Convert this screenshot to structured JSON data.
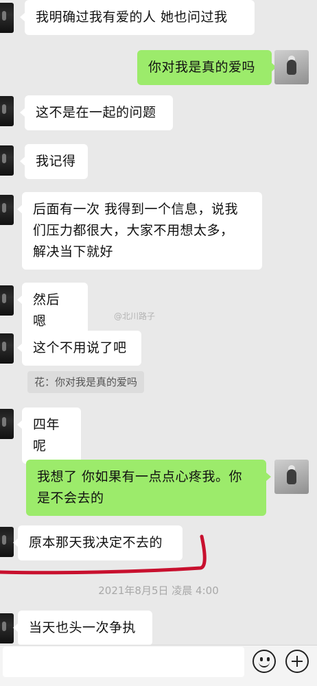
{
  "messages": [
    {
      "side": "left",
      "text": "我明确过我有爱的人 她也问过我"
    },
    {
      "side": "right",
      "text": "你对我是真的爱吗"
    },
    {
      "side": "left",
      "text": "这不是在一起的问题"
    },
    {
      "side": "left",
      "text": "我记得"
    },
    {
      "side": "left",
      "lines": [
        "后面有一次 我得到一个信息，说我",
        "们压力都很大，大家不用想太多，",
        "解决当下就好"
      ]
    },
    {
      "side": "left",
      "text": "然后 嗯"
    },
    {
      "side": "left",
      "text": "这个不用说了吧",
      "quote": "花：你对我是真的爱吗"
    },
    {
      "side": "left",
      "text": "四年呢"
    },
    {
      "side": "right",
      "lines": [
        "我想了 你如果有一点点心疼我。你",
        "是不会去的"
      ]
    },
    {
      "side": "left",
      "text": "原本那天我决定不去的"
    },
    {
      "side": "left",
      "text": "当天也头一次争执"
    }
  ],
  "watermark": "@北川路子",
  "timestamp": "2021年8月5日 凌晨 4:00",
  "input": {
    "value": "",
    "placeholder": ""
  },
  "colors": {
    "background": "#e9e9e9",
    "bubble_left": "#ffffff",
    "bubble_right": "#9ceb6b",
    "annotation": "#c8102e"
  },
  "icons": {
    "emoji": "smiley-icon",
    "more": "plus-circle-icon"
  }
}
